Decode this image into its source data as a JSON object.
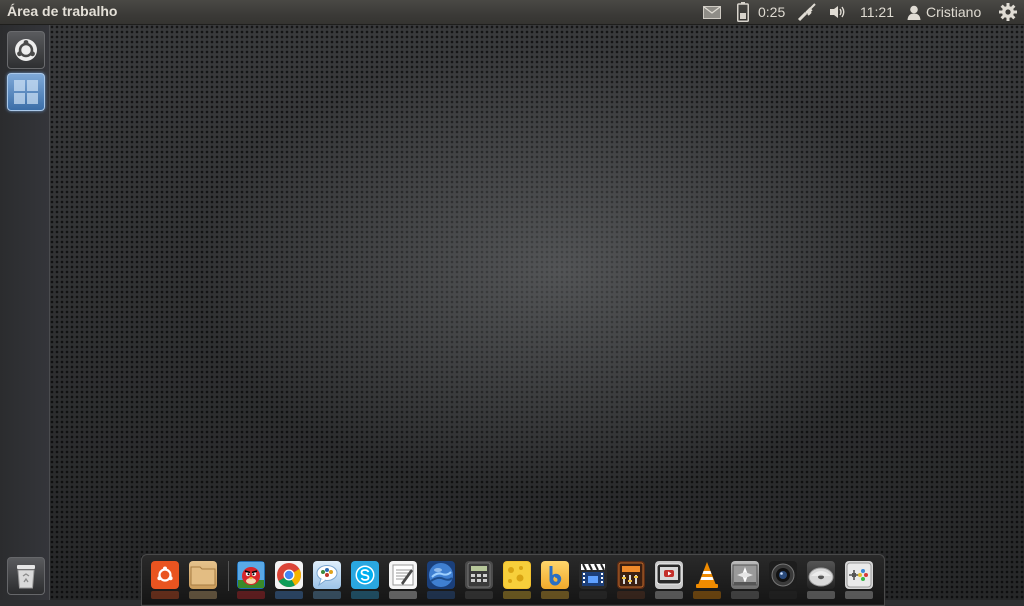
{
  "top_panel": {
    "app_title": "Área de trabalho",
    "battery_time": "0:25",
    "clock": "11:21",
    "user_name": "Cristiano"
  },
  "launcher": {
    "items": [
      {
        "name": "dash-home",
        "icon": "ubuntu-logo-icon"
      },
      {
        "name": "workspace-switcher",
        "icon": "workspace-icon"
      }
    ],
    "trash": {
      "icon": "trash-icon"
    }
  },
  "dock": {
    "items": [
      {
        "icon": "ubuntu-software-icon",
        "color": "#e95420"
      },
      {
        "icon": "folder-icon",
        "color": "#d9b57a"
      },
      {
        "icon": "angry-birds-icon",
        "color": "#d8262b"
      },
      {
        "icon": "chrome-icon",
        "color": "#4a90e2"
      },
      {
        "icon": "chat-icon",
        "color": "#6aa6d8"
      },
      {
        "icon": "skype-icon",
        "color": "#2aa7e0"
      },
      {
        "icon": "text-editor-icon",
        "color": "#e8e8e8"
      },
      {
        "icon": "google-earth-icon",
        "color": "#2a5fa8"
      },
      {
        "icon": "calculator-icon",
        "color": "#5a5a5a"
      },
      {
        "icon": "cheese-icon",
        "color": "#f4c22e"
      },
      {
        "icon": "banshee-icon",
        "color": "#f2b632"
      },
      {
        "icon": "video-editor-icon",
        "color": "#3a3a3a"
      },
      {
        "icon": "audio-mixer-icon",
        "color": "#6a3a22"
      },
      {
        "icon": "tv-player-icon",
        "color": "#c9c9c9"
      },
      {
        "icon": "vlc-icon",
        "color": "#f08b00"
      },
      {
        "icon": "scanner-icon",
        "color": "#888888"
      },
      {
        "icon": "webcam-icon",
        "color": "#2a2a2a"
      },
      {
        "icon": "disc-burner-icon",
        "color": "#bfbfbf"
      },
      {
        "icon": "game-controller-icon",
        "color": "#cfcfcf"
      }
    ]
  }
}
